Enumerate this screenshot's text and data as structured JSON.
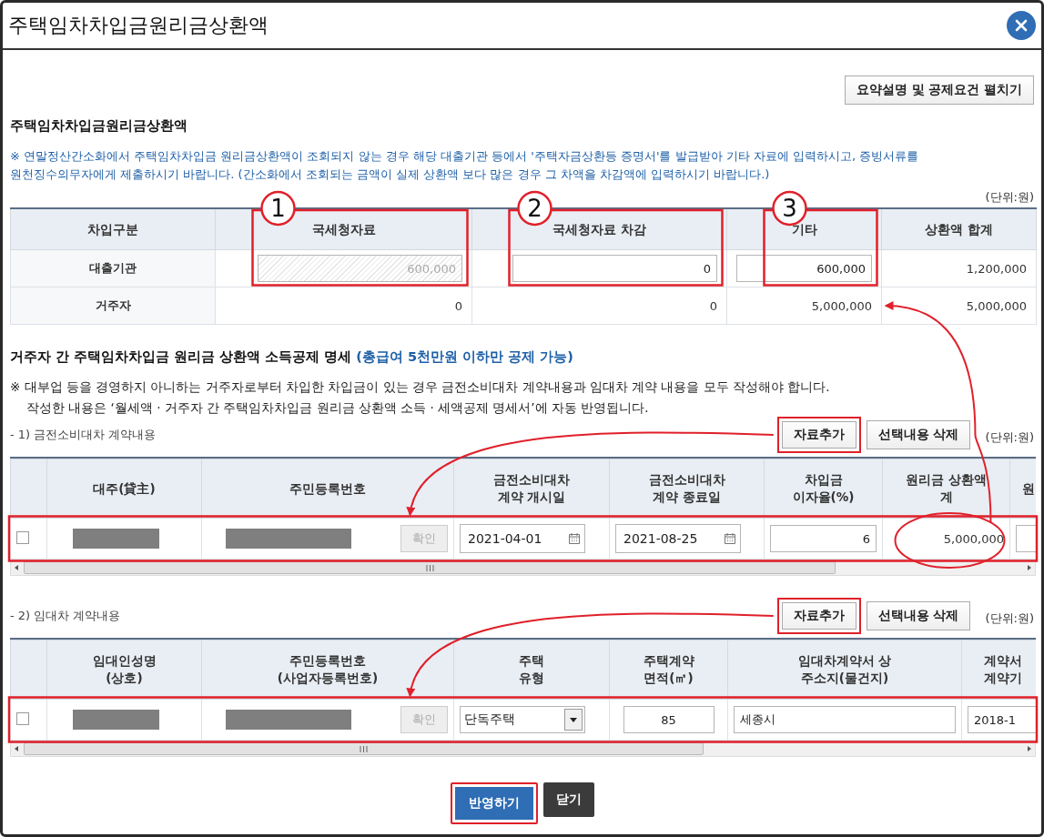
{
  "window": {
    "title": "주택임차차입금원리금상환액"
  },
  "summary_button": {
    "label": "요약설명 및 공제요건 펼치기"
  },
  "deduction_section": {
    "heading": "주택임차차입금원리금상환액",
    "notice": "※ 연말정산간소화에서 주택임차차입금 원리금상환액이 조회되지 않는 경우 해당 대출기관 등에서 '주택자금상환등 증명서'를 발급받아 기타 자료에 입력하시고, 증빙서류를 원천징수의무자에게 제출하시기 바랍니다. (간소화에서 조회되는 금액이 실제 상환액 보다 많은 경우 그 차액을 차감액에 입력하시기 바랍니다.)",
    "unit": "(단위:원)",
    "table": {
      "columns": [
        {
          "label": "차입구분",
          "highlighted": false
        },
        {
          "label": "국세청자료",
          "highlighted": true,
          "marker": "1"
        },
        {
          "label": "국세청자료 차감",
          "highlighted": true,
          "marker": "2"
        },
        {
          "label": "기타",
          "highlighted": true,
          "marker": "3"
        },
        {
          "label": "상환액 합계",
          "highlighted": false
        }
      ],
      "rows": [
        {
          "cells": [
            {
              "kind": "label",
              "value": "대출기관"
            },
            {
              "kind": "input",
              "value": "600,000",
              "disabled": true
            },
            {
              "kind": "input",
              "value": "0",
              "disabled": false
            },
            {
              "kind": "input",
              "value": "600,000",
              "disabled": false
            },
            {
              "kind": "text",
              "value": "1,200,000"
            }
          ]
        },
        {
          "cells": [
            {
              "kind": "label",
              "value": "거주자"
            },
            {
              "kind": "text",
              "value": "0"
            },
            {
              "kind": "text",
              "value": "0"
            },
            {
              "kind": "text",
              "value": "5,000,000",
              "pointed": true
            },
            {
              "kind": "text",
              "value": "5,000,000"
            }
          ]
        }
      ]
    }
  },
  "detail_section": {
    "heading": "거주자 간 주택임차차입금 원리금 상환액 소득공제 명세",
    "heading_note": "(총급여 5천만원 이하만 공제 가능)",
    "notes": [
      "※ 대부업 등을 경영하지 아니하는 거주자로부터 차입한 차입금이 있는 경우 금전소비대차 계약내용과 임대차 계약 내용을 모두 작성해야 합니다.",
      "작성한 내용은 ‘월세액 · 거주자 간 주택임차차입금 원리금 상환액 소득 · 세액공제 명세서’에 자동 반영됩니다."
    ],
    "subsections": [
      {
        "title": "- 1) 금전소비대차 계약내용",
        "buttons": [
          {
            "label": "자료추가",
            "highlighted": true
          },
          {
            "label": "선택내용 삭제",
            "highlighted": false
          }
        ],
        "unit": "(단위:원)",
        "columns": [
          {
            "label": "대주(貸主)"
          },
          {
            "label": "주민등록번호"
          },
          {
            "label": "금전소비대차\n계약 개시일"
          },
          {
            "label": "금전소비대차\n계약 종료일"
          },
          {
            "label": "차입금\n이자율(%)"
          },
          {
            "label": "원리금 상환액\n계"
          },
          {
            "label": "원"
          }
        ],
        "rows": [
          {
            "checked": false,
            "highlighted": true,
            "cells": [
              {
                "kind": "redacted"
              },
              {
                "kind": "id",
                "button": "확인",
                "disabled": true
              },
              {
                "kind": "date",
                "value": "2021-04-01"
              },
              {
                "kind": "date",
                "value": "2021-08-25"
              },
              {
                "kind": "amount",
                "value": "6"
              },
              {
                "kind": "text",
                "value": "5,000,000",
                "circled": true
              },
              {
                "kind": "amount"
              }
            ]
          }
        ]
      },
      {
        "title": "- 2) 임대차 계약내용",
        "buttons": [
          {
            "label": "자료추가",
            "highlighted": true
          },
          {
            "label": "선택내용 삭제",
            "highlighted": false
          }
        ],
        "unit": "(단위:원)",
        "columns": [
          {
            "label": "임대인성명\n(상호)"
          },
          {
            "label": "주민등록번호\n(사업자등록번호)"
          },
          {
            "label": "주택\n유형"
          },
          {
            "label": "주택계약\n면적(㎡)"
          },
          {
            "label": "임대차계약서 상\n주소지(물건지)"
          },
          {
            "label": "계약서\n계약기"
          }
        ],
        "rows": [
          {
            "checked": false,
            "highlighted": true,
            "cells": [
              {
                "kind": "redacted"
              },
              {
                "kind": "id",
                "button": "확인",
                "disabled": true
              },
              {
                "kind": "select",
                "value": "단독주택"
              },
              {
                "kind": "area",
                "value": "85"
              },
              {
                "kind": "address",
                "value": "세종시"
              },
              {
                "kind": "address",
                "value": "2018-1"
              }
            ]
          }
        ]
      }
    ]
  },
  "footer_buttons": [
    {
      "label": "반영하기",
      "kind": "primary",
      "highlighted": true
    },
    {
      "label": "닫기",
      "kind": "secondary",
      "highlighted": false
    }
  ]
}
